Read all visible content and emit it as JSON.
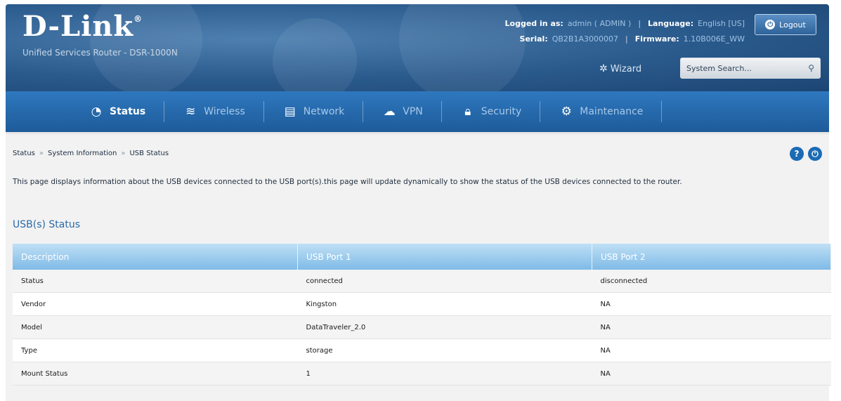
{
  "header": {
    "brand": "D-Link",
    "subtitle": "Unified Services Router - DSR-1000N",
    "logged_in_label": "Logged in as:",
    "logged_in_value": "admin ( ADMIN )",
    "language_label": "Language:",
    "language_value": "English [US]",
    "serial_label": "Serial:",
    "serial_value": "QB2B1A3000007",
    "firmware_label": "Firmware:",
    "firmware_value": "1.10B006E_WW",
    "logout_label": "Logout",
    "wizard_label": "Wizard",
    "search_placeholder": "System Search..."
  },
  "nav": {
    "items": [
      {
        "label": "Status",
        "icon": "gauge-icon",
        "active": true
      },
      {
        "label": "Wireless",
        "icon": "wifi-icon",
        "active": false
      },
      {
        "label": "Network",
        "icon": "network-icon",
        "active": false
      },
      {
        "label": "VPN",
        "icon": "cloud-lock-icon",
        "active": false
      },
      {
        "label": "Security",
        "icon": "lock-icon",
        "active": false
      },
      {
        "label": "Maintenance",
        "icon": "gear-icon",
        "active": false
      }
    ]
  },
  "breadcrumb": [
    "Status",
    "System Information",
    "USB Status"
  ],
  "page": {
    "description": "This page displays information about the USB devices connected to the USB port(s).this page will update dynamically to show the status of the USB devices connected to the router.",
    "section_title": "USB(s) Status"
  },
  "table": {
    "headers": [
      "Description",
      "USB Port 1",
      "USB Port 2"
    ],
    "rows": [
      [
        "Status",
        "connected",
        "disconnected"
      ],
      [
        "Vendor",
        "Kingston",
        "NA"
      ],
      [
        "Model",
        "DataTraveler_2.0",
        "NA"
      ],
      [
        "Type",
        "storage",
        "NA"
      ],
      [
        "Mount Status",
        "1",
        "NA"
      ]
    ]
  },
  "colors": {
    "accent": "#1b6bb4",
    "header_bg": "#2a5a8c",
    "nav_bg": "#2f78bf"
  }
}
